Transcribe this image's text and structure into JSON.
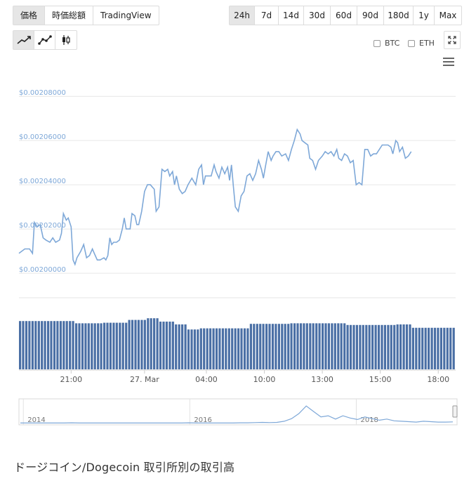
{
  "tabs": {
    "main": [
      {
        "label": "価格",
        "active": true
      },
      {
        "label": "時価総額",
        "active": false
      },
      {
        "label": "TradingView",
        "active": false
      }
    ],
    "range": [
      {
        "label": "24h",
        "active": true
      },
      {
        "label": "7d",
        "active": false
      },
      {
        "label": "14d",
        "active": false
      },
      {
        "label": "30d",
        "active": false
      },
      {
        "label": "60d",
        "active": false
      },
      {
        "label": "90d",
        "active": false
      },
      {
        "label": "180d",
        "active": false
      },
      {
        "label": "1y",
        "active": false
      },
      {
        "label": "Max",
        "active": false
      }
    ]
  },
  "chart_types": [
    {
      "icon": "line-chart-icon",
      "active": true
    },
    {
      "icon": "line-points-chart-icon",
      "active": false
    },
    {
      "icon": "candlestick-chart-icon",
      "active": false
    }
  ],
  "compare": {
    "btc_label": "BTC",
    "eth_label": "ETH"
  },
  "footer": {
    "title": "ドージコイン/Dogecoin 取引所別の取引高"
  },
  "colors": {
    "price_line": "#7ea8d8",
    "volume_bar": "#4a6fa5",
    "axis_label": "#7ea8d8",
    "grid": "#e6e6e6"
  },
  "chart_data": {
    "type": "line",
    "title": "",
    "xlabel": "",
    "ylabel": "",
    "y_tick_labels": [
      "$0.00200000",
      "$0.00202000",
      "$0.00204000",
      "$0.00206000",
      "$0.00208000"
    ],
    "y_ticks": [
      0.002,
      0.00202,
      0.00204,
      0.00206,
      0.00208
    ],
    "ylim": [
      0.001994,
      0.002088
    ],
    "x_tick_labels": [
      "21:00",
      "27. Mar",
      "04:00",
      "10:00",
      "13:00",
      "15:00",
      "18:00"
    ],
    "x_tick_hours": [
      2.7,
      6.5,
      9.7,
      12.7,
      15.7,
      18.7,
      21.7
    ],
    "xlim": [
      0,
      22.6
    ],
    "series": [
      {
        "values": [
          [
            0.0,
            0.002009
          ],
          [
            0.3,
            0.002011
          ],
          [
            0.55,
            0.002011
          ],
          [
            0.7,
            0.002009
          ],
          [
            0.8,
            0.002023
          ],
          [
            0.95,
            0.002021
          ],
          [
            1.1,
            0.002022
          ],
          [
            1.25,
            0.002016
          ],
          [
            1.4,
            0.002015
          ],
          [
            1.6,
            0.002014
          ],
          [
            1.75,
            0.002016
          ],
          [
            1.9,
            0.002014
          ],
          [
            2.1,
            0.002015
          ],
          [
            2.2,
            0.002018
          ],
          [
            2.3,
            0.002027
          ],
          [
            2.45,
            0.002024
          ],
          [
            2.55,
            0.002025
          ],
          [
            2.7,
            0.002021
          ],
          [
            2.8,
            0.002006
          ],
          [
            2.9,
            0.002004
          ],
          [
            3.0,
            0.002007
          ],
          [
            3.2,
            0.00201
          ],
          [
            3.35,
            0.002013
          ],
          [
            3.5,
            0.002007
          ],
          [
            3.65,
            0.002008
          ],
          [
            3.8,
            0.002011
          ],
          [
            3.9,
            0.002009
          ],
          [
            4.05,
            0.002006
          ],
          [
            4.2,
            0.002006
          ],
          [
            4.4,
            0.002007
          ],
          [
            4.5,
            0.002006
          ],
          [
            4.6,
            0.002008
          ],
          [
            4.7,
            0.002016
          ],
          [
            4.8,
            0.002013
          ],
          [
            4.9,
            0.002014
          ],
          [
            5.05,
            0.002014
          ],
          [
            5.2,
            0.002015
          ],
          [
            5.35,
            0.00202
          ],
          [
            5.45,
            0.002025
          ],
          [
            5.55,
            0.00202
          ],
          [
            5.75,
            0.00202
          ],
          [
            5.85,
            0.002027
          ],
          [
            6.0,
            0.002026
          ],
          [
            6.1,
            0.002022
          ],
          [
            6.2,
            0.002022
          ],
          [
            6.35,
            0.002028
          ],
          [
            6.5,
            0.002037
          ],
          [
            6.65,
            0.00204
          ],
          [
            6.8,
            0.00204
          ],
          [
            6.9,
            0.002039
          ],
          [
            7.0,
            0.002038
          ],
          [
            7.1,
            0.002028
          ],
          [
            7.25,
            0.00203
          ],
          [
            7.4,
            0.002047
          ],
          [
            7.55,
            0.002046
          ],
          [
            7.7,
            0.002047
          ],
          [
            7.8,
            0.002044
          ],
          [
            7.95,
            0.002046
          ],
          [
            8.05,
            0.00204
          ],
          [
            8.15,
            0.002044
          ],
          [
            8.3,
            0.002038
          ],
          [
            8.45,
            0.002036
          ],
          [
            8.6,
            0.002037
          ],
          [
            8.75,
            0.00204
          ],
          [
            8.95,
            0.002043
          ],
          [
            9.15,
            0.00204
          ],
          [
            9.3,
            0.002047
          ],
          [
            9.45,
            0.002049
          ],
          [
            9.55,
            0.00204
          ],
          [
            9.65,
            0.002044
          ],
          [
            9.8,
            0.002044
          ],
          [
            9.95,
            0.002044
          ],
          [
            10.1,
            0.002049
          ],
          [
            10.2,
            0.002046
          ],
          [
            10.35,
            0.002043
          ],
          [
            10.5,
            0.002048
          ],
          [
            10.65,
            0.002045
          ],
          [
            10.8,
            0.002048
          ],
          [
            10.9,
            0.002042
          ],
          [
            11.0,
            0.002049
          ],
          [
            11.1,
            0.002039
          ],
          [
            11.2,
            0.00203
          ],
          [
            11.35,
            0.002028
          ],
          [
            11.5,
            0.002035
          ],
          [
            11.65,
            0.002037
          ],
          [
            11.8,
            0.002044
          ],
          [
            11.95,
            0.002045
          ],
          [
            12.1,
            0.002042
          ],
          [
            12.25,
            0.002045
          ],
          [
            12.4,
            0.002051
          ],
          [
            12.55,
            0.002047
          ],
          [
            12.65,
            0.002043
          ],
          [
            12.75,
            0.002048
          ],
          [
            12.9,
            0.002055
          ],
          [
            13.05,
            0.002051
          ],
          [
            13.15,
            0.002053
          ],
          [
            13.3,
            0.002055
          ],
          [
            13.45,
            0.002055
          ],
          [
            13.6,
            0.002053
          ],
          [
            13.8,
            0.002054
          ],
          [
            13.95,
            0.002051
          ],
          [
            14.1,
            0.002056
          ],
          [
            14.25,
            0.00206
          ],
          [
            14.4,
            0.002065
          ],
          [
            14.55,
            0.002063
          ],
          [
            14.65,
            0.00206
          ],
          [
            14.8,
            0.002059
          ],
          [
            14.95,
            0.002058
          ],
          [
            15.05,
            0.002052
          ],
          [
            15.2,
            0.002051
          ],
          [
            15.35,
            0.002047
          ],
          [
            15.5,
            0.002051
          ],
          [
            15.7,
            0.002053
          ],
          [
            15.85,
            0.002055
          ],
          [
            16.0,
            0.002054
          ],
          [
            16.15,
            0.002055
          ],
          [
            16.3,
            0.002053
          ],
          [
            16.45,
            0.002056
          ],
          [
            16.55,
            0.002052
          ],
          [
            16.7,
            0.002051
          ],
          [
            16.85,
            0.002054
          ],
          [
            17.0,
            0.002053
          ],
          [
            17.15,
            0.00205
          ],
          [
            17.3,
            0.002051
          ],
          [
            17.45,
            0.00204
          ],
          [
            17.6,
            0.002041
          ],
          [
            17.75,
            0.00204
          ],
          [
            17.9,
            0.002056
          ],
          [
            18.05,
            0.002056
          ],
          [
            18.2,
            0.002053
          ],
          [
            18.35,
            0.002054
          ],
          [
            18.5,
            0.002054
          ],
          [
            18.65,
            0.002056
          ],
          [
            18.8,
            0.002058
          ],
          [
            18.95,
            0.002058
          ],
          [
            19.1,
            0.002058
          ],
          [
            19.25,
            0.002057
          ],
          [
            19.35,
            0.002054
          ],
          [
            19.5,
            0.00206
          ],
          [
            19.6,
            0.002059
          ],
          [
            19.7,
            0.002055
          ],
          [
            19.85,
            0.002057
          ],
          [
            20.0,
            0.002052
          ],
          [
            20.15,
            0.002053
          ],
          [
            20.3,
            0.002055
          ]
        ]
      }
    ],
    "volume": {
      "levels": [
        [
          0.0,
          0.0,
          0.86
        ],
        [
          2.8,
          0.0,
          0.82
        ],
        [
          4.2,
          0.0,
          0.83
        ],
        [
          5.6,
          0.0,
          0.88
        ],
        [
          6.5,
          0.0,
          0.91
        ],
        [
          7.2,
          0.0,
          0.85
        ],
        [
          8.0,
          0.0,
          0.8
        ],
        [
          8.7,
          0.0,
          0.71
        ],
        [
          9.3,
          0.0,
          0.73
        ],
        [
          11.8,
          0.0,
          0.81
        ],
        [
          14.0,
          0.0,
          0.82
        ],
        [
          16.8,
          0.0,
          0.79
        ],
        [
          19.5,
          0.0,
          0.8
        ],
        [
          20.2,
          0.0,
          0.74
        ]
      ]
    },
    "navigator": {
      "labels": [
        "2014",
        "2016",
        "2018"
      ],
      "label_positions": [
        0.01,
        0.39,
        0.77
      ]
    },
    "grid": true,
    "legend": "none"
  }
}
